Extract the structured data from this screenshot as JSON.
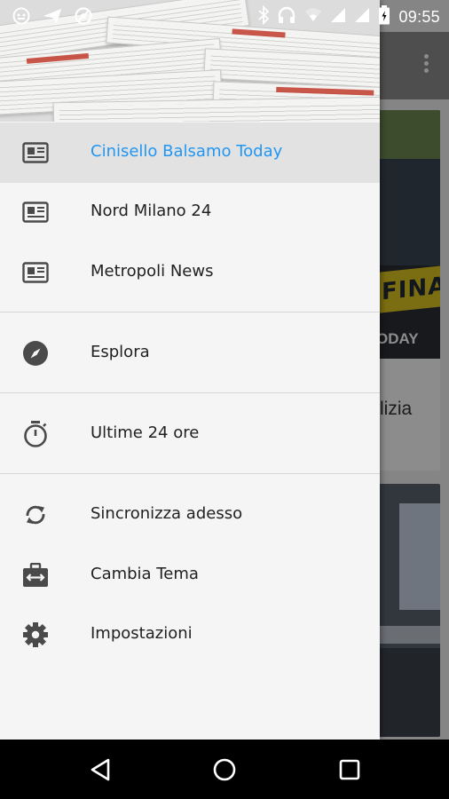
{
  "status_bar": {
    "time": "09:55",
    "left_icons": [
      "android-icon",
      "send-icon",
      "blocked-icon"
    ],
    "right_icons": [
      "bluetooth-icon",
      "headset-icon",
      "wifi-icon",
      "signal-icon",
      "signal-icon",
      "battery-icon"
    ]
  },
  "background_app": {
    "card1_image_text": "FINAN",
    "card1_brand": "ODAY",
    "card1_text": "lizia"
  },
  "drawer": {
    "feeds": [
      {
        "label": "Cinisello Balsamo Today",
        "icon": "newspaper-icon",
        "active": true
      },
      {
        "label": "Nord Milano 24",
        "icon": "newspaper-icon",
        "active": false
      },
      {
        "label": "Metropoli News",
        "icon": "newspaper-icon",
        "active": false
      }
    ],
    "explore": {
      "label": "Esplora",
      "icon": "compass-icon"
    },
    "recent": {
      "label": "Ultime 24 ore",
      "icon": "stopwatch-icon"
    },
    "actions": [
      {
        "label": "Sincronizza adesso",
        "icon": "sync-icon"
      },
      {
        "label": "Cambia Tema",
        "icon": "theme-swap-icon"
      },
      {
        "label": "Impostazioni",
        "icon": "settings-icon"
      }
    ]
  },
  "nav_bar": {
    "buttons": [
      "back-icon",
      "home-icon",
      "recents-icon"
    ]
  },
  "colors": {
    "accent": "#2196f3",
    "drawer_bg": "#f5f5f5",
    "active_bg": "#e2e2e2",
    "icon": "#4a4a4a"
  }
}
